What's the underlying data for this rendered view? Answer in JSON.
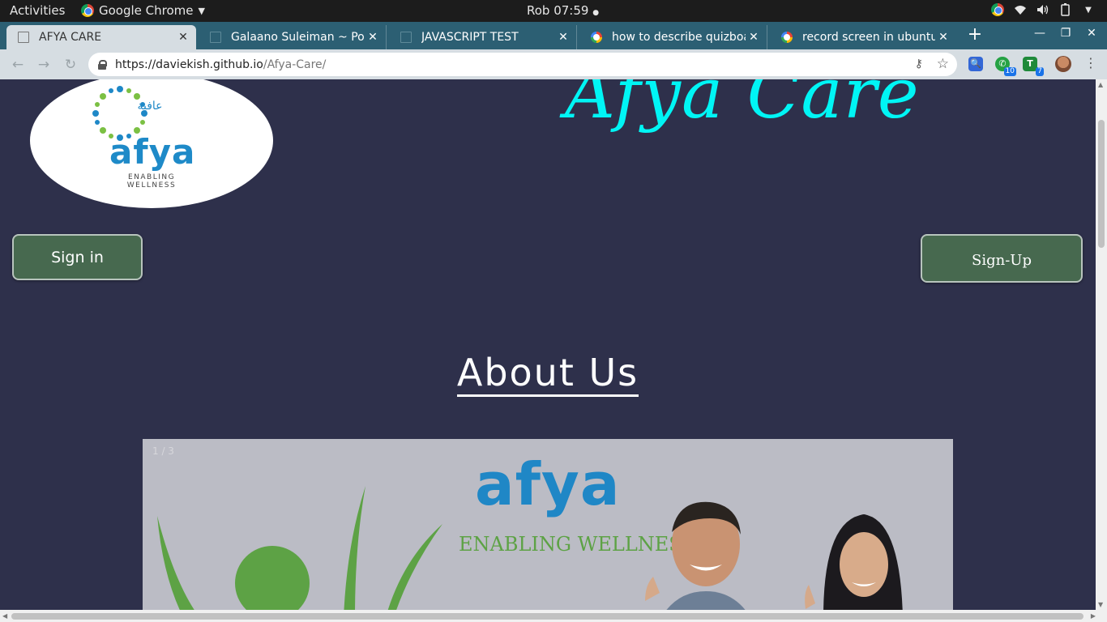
{
  "os": {
    "activities": "Activities",
    "app_name": "Google Chrome",
    "clock": "Rob 07:59"
  },
  "tabs": [
    {
      "title": "AFYA CARE",
      "favicon": "doc-icon",
      "active": true
    },
    {
      "title": "Galaano Suleiman ~ Portf",
      "favicon": "doc-icon",
      "active": false
    },
    {
      "title": "JAVASCRIPT TEST",
      "favicon": "doc-icon",
      "active": false
    },
    {
      "title": "how to describe quizboa",
      "favicon": "google-icon",
      "active": false
    },
    {
      "title": "record screen in ubuntu",
      "favicon": "google-icon",
      "active": false
    }
  ],
  "toolbar": {
    "url_host": "https://daviekish.github.io",
    "url_path": "/Afya-Care/"
  },
  "extensions": [
    {
      "name": "search-extension-icon",
      "color": "#3367d6",
      "badge": ""
    },
    {
      "name": "whatsapp-extension-icon",
      "color": "#25a244",
      "badge": "10"
    },
    {
      "name": "trello-extension-icon",
      "color": "#1f8a3a",
      "badge": "7"
    }
  ],
  "site": {
    "logo": {
      "arabic": "عافية",
      "word": "afya",
      "tagline": "ENABLING WELLNESS"
    },
    "brand_title": "Afya Care",
    "signin_label": "Sign in",
    "signup_label": "Sign-Up",
    "about_heading": "About Us",
    "slider": {
      "counter": "1 / 3",
      "word": "afya",
      "tagline": "ENABLING WELLNESS"
    }
  },
  "colors": {
    "page_bg": "#2e304b",
    "brand_title": "#00f5f5",
    "button_bg": "#47694f",
    "tab_strip": "#2c5f73"
  }
}
